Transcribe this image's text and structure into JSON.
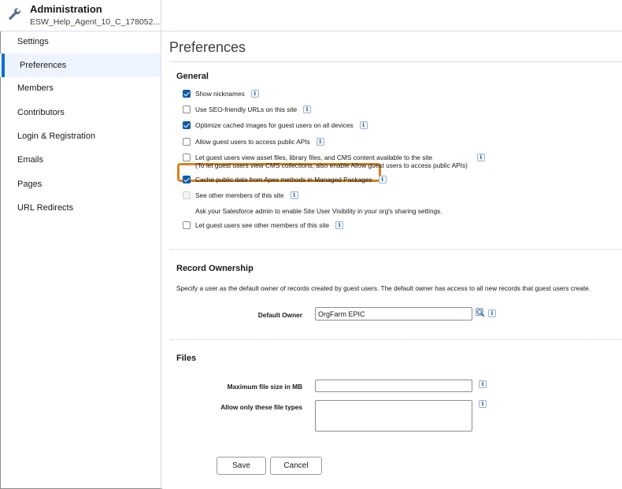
{
  "header": {
    "title": "Administration",
    "subtitle": "ESW_Help_Agent_10_C_178052..."
  },
  "sidebar": {
    "items": [
      {
        "label": "Settings"
      },
      {
        "label": "Preferences",
        "active": true
      },
      {
        "label": "Members"
      },
      {
        "label": "Contributors"
      },
      {
        "label": "Login & Registration"
      },
      {
        "label": "Emails"
      },
      {
        "label": "Pages"
      },
      {
        "label": "URL Redirects"
      }
    ]
  },
  "main": {
    "title": "Preferences",
    "general": {
      "heading": "General",
      "options": [
        {
          "label": "Show nicknames",
          "checked": true
        },
        {
          "label": "Use SEO-friendly URLs on this site",
          "checked": false
        },
        {
          "label": "Optimize cached images for guest users on all devices",
          "checked": true
        },
        {
          "label": "Allow guest users to access public APIs",
          "checked": false
        },
        {
          "label": "Let guest users view asset files, library files, and CMS content available to the site",
          "label2": "(To let guest users view CMS collections, also enable Allow guest users to access public APIs)",
          "checked": false
        },
        {
          "label": "Cache public data from Apex methods in Managed Packages",
          "checked": true
        },
        {
          "label": "See other members of this site",
          "checked": false,
          "disabled": true
        },
        {
          "label": "Let guest users see other members of this site",
          "checked": false
        }
      ],
      "note": "Ask your Salesforce admin to enable Site User Visibility in your org's sharing settings."
    },
    "record_ownership": {
      "heading": "Record Ownership",
      "description": "Specify a user as the default owner of records created by guest users. The default owner has access to all new records that guest users create.",
      "default_owner_label": "Default Owner",
      "default_owner_value": "OrgFarm EPIC"
    },
    "files": {
      "heading": "Files",
      "max_size_label": "Maximum file size in MB",
      "max_size_value": "",
      "file_types_label": "Allow only these file types",
      "file_types_value": ""
    },
    "buttons": {
      "save": "Save",
      "cancel": "Cancel"
    },
    "info_glyph": "i"
  },
  "colors": {
    "accent": "#0070d2",
    "checkbox_checked": "#0b5cab",
    "highlight": "#d9821e"
  }
}
